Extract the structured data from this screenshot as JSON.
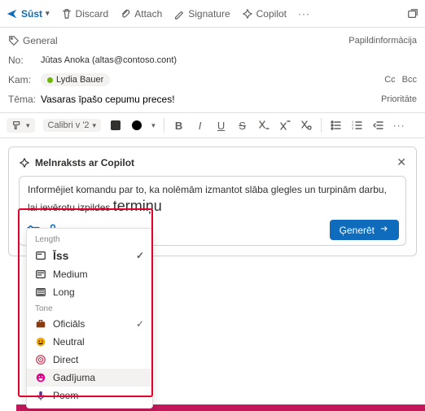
{
  "topbar": {
    "send": "Sūst",
    "discard": "Discard",
    "attach": "Attach",
    "signature": "Signature",
    "copilot": "Copilot"
  },
  "tag": {
    "label": "General"
  },
  "extra_info": "Papildinformācija",
  "fields": {
    "from_label": "No:",
    "from_value": "Jūtas Anoka (altas@contoso.cont)",
    "to_label": "Kam:",
    "to_chip": "Lydia Bauer",
    "cc": "Cc",
    "bcc": "Bcc",
    "subject_label": "Tēma:",
    "subject_value": "Vasaras īpašo cepumu preces!",
    "priority": "Prioritāte"
  },
  "fmt": {
    "font": "Calibri v '2"
  },
  "copilot_card": {
    "title": "Melnraksts ar Copilot",
    "prompt_line1": "Informējiet komandu par to, ka nolēmām izmantot slāba glegles un turpinām darbu, lai ievērotu izpildes",
    "prompt_line2": "termiņu",
    "generate": "Ģenerēt"
  },
  "menu": {
    "group_length": "Length",
    "length": [
      {
        "label": "Īss",
        "selected": true
      },
      {
        "label": "Medium",
        "selected": false
      },
      {
        "label": "Long",
        "selected": false
      }
    ],
    "group_tone": "Tone",
    "tone": [
      {
        "label": "Oficiāls",
        "selected": true,
        "icon": "briefcase",
        "color": "#8a3b0e"
      },
      {
        "label": "Neutral",
        "selected": false,
        "icon": "smile",
        "color": "#f7a500"
      },
      {
        "label": "Direct",
        "selected": false,
        "icon": "target",
        "color": "#c43a56"
      },
      {
        "label": "Gadījuma",
        "selected": false,
        "icon": "grin",
        "color": "#e3008c",
        "hl": true
      },
      {
        "label": "Poem",
        "selected": false,
        "icon": "mic",
        "color": "#5c2e91"
      }
    ]
  }
}
